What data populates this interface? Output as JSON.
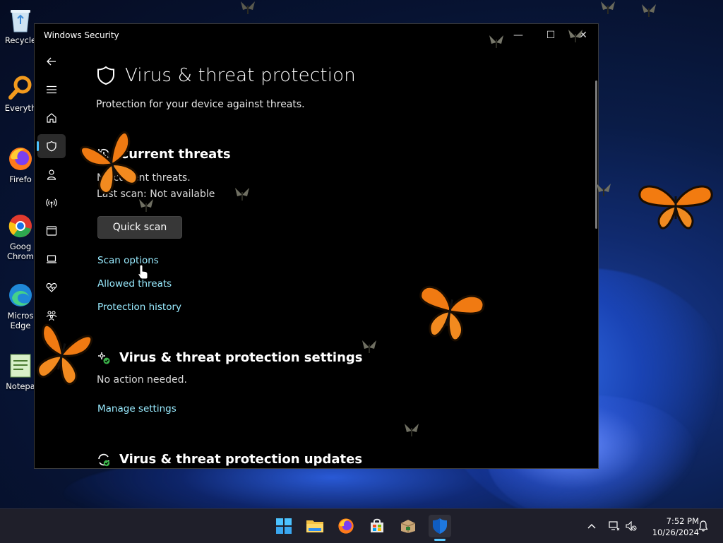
{
  "desktop": {
    "icons": [
      {
        "label": "Recycle",
        "icon": "recycle-bin-icon"
      },
      {
        "label": "Everyth",
        "icon": "everything-search-icon"
      },
      {
        "label": "Firefo",
        "icon": "firefox-icon"
      },
      {
        "label": "Goog",
        "label2": "Chrom",
        "icon": "chrome-icon"
      },
      {
        "label": "Micros",
        "label2": "Edge",
        "icon": "edge-icon"
      },
      {
        "label": "Notepa",
        "icon": "notepad-icon"
      }
    ]
  },
  "window": {
    "title": "Windows Security",
    "controls": {
      "minimize": "—",
      "maximize": "☐",
      "close": "✕"
    }
  },
  "nav": {
    "items": [
      {
        "name": "back",
        "icon": "back-arrow-icon"
      },
      {
        "name": "menu",
        "icon": "hamburger-menu-icon"
      },
      {
        "name": "home",
        "icon": "home-icon"
      },
      {
        "name": "virus-protection",
        "icon": "shield-icon",
        "active": true
      },
      {
        "name": "account-protection",
        "icon": "person-icon"
      },
      {
        "name": "firewall",
        "icon": "network-icon"
      },
      {
        "name": "app-browser-control",
        "icon": "app-window-icon"
      },
      {
        "name": "device-security",
        "icon": "laptop-icon"
      },
      {
        "name": "device-performance",
        "icon": "heart-pulse-icon"
      },
      {
        "name": "family-options",
        "icon": "family-icon"
      },
      {
        "name": "settings",
        "icon": "gear-icon"
      }
    ]
  },
  "main": {
    "title": "Virus & threat protection",
    "subtitle": "Protection for your device against threats.",
    "current_threats": {
      "heading": "Current threats",
      "status": "No current threats.",
      "last_scan": "Last scan: Not available",
      "quick_scan_label": "Quick scan",
      "links": [
        "Scan options",
        "Allowed threats",
        "Protection history"
      ]
    },
    "settings_section": {
      "heading": "Virus & threat protection settings",
      "status": "No action needed.",
      "link": "Manage settings"
    },
    "updates_section": {
      "heading": "Virus & threat protection updates"
    }
  },
  "taskbar": {
    "apps": [
      {
        "name": "start",
        "icon": "windows-start-icon"
      },
      {
        "name": "file-explorer",
        "icon": "folder-icon"
      },
      {
        "name": "firefox",
        "icon": "firefox-icon"
      },
      {
        "name": "microsoft-store",
        "icon": "store-icon"
      },
      {
        "name": "package",
        "icon": "package-icon"
      },
      {
        "name": "windows-security",
        "icon": "security-shield-icon",
        "active": true
      }
    ],
    "time": "7:52 PM",
    "date": "10/26/2024"
  },
  "colors": {
    "accent": "#4cc2ff",
    "link": "#99ebff",
    "window_bg": "#000000",
    "button_bg": "#373737"
  }
}
